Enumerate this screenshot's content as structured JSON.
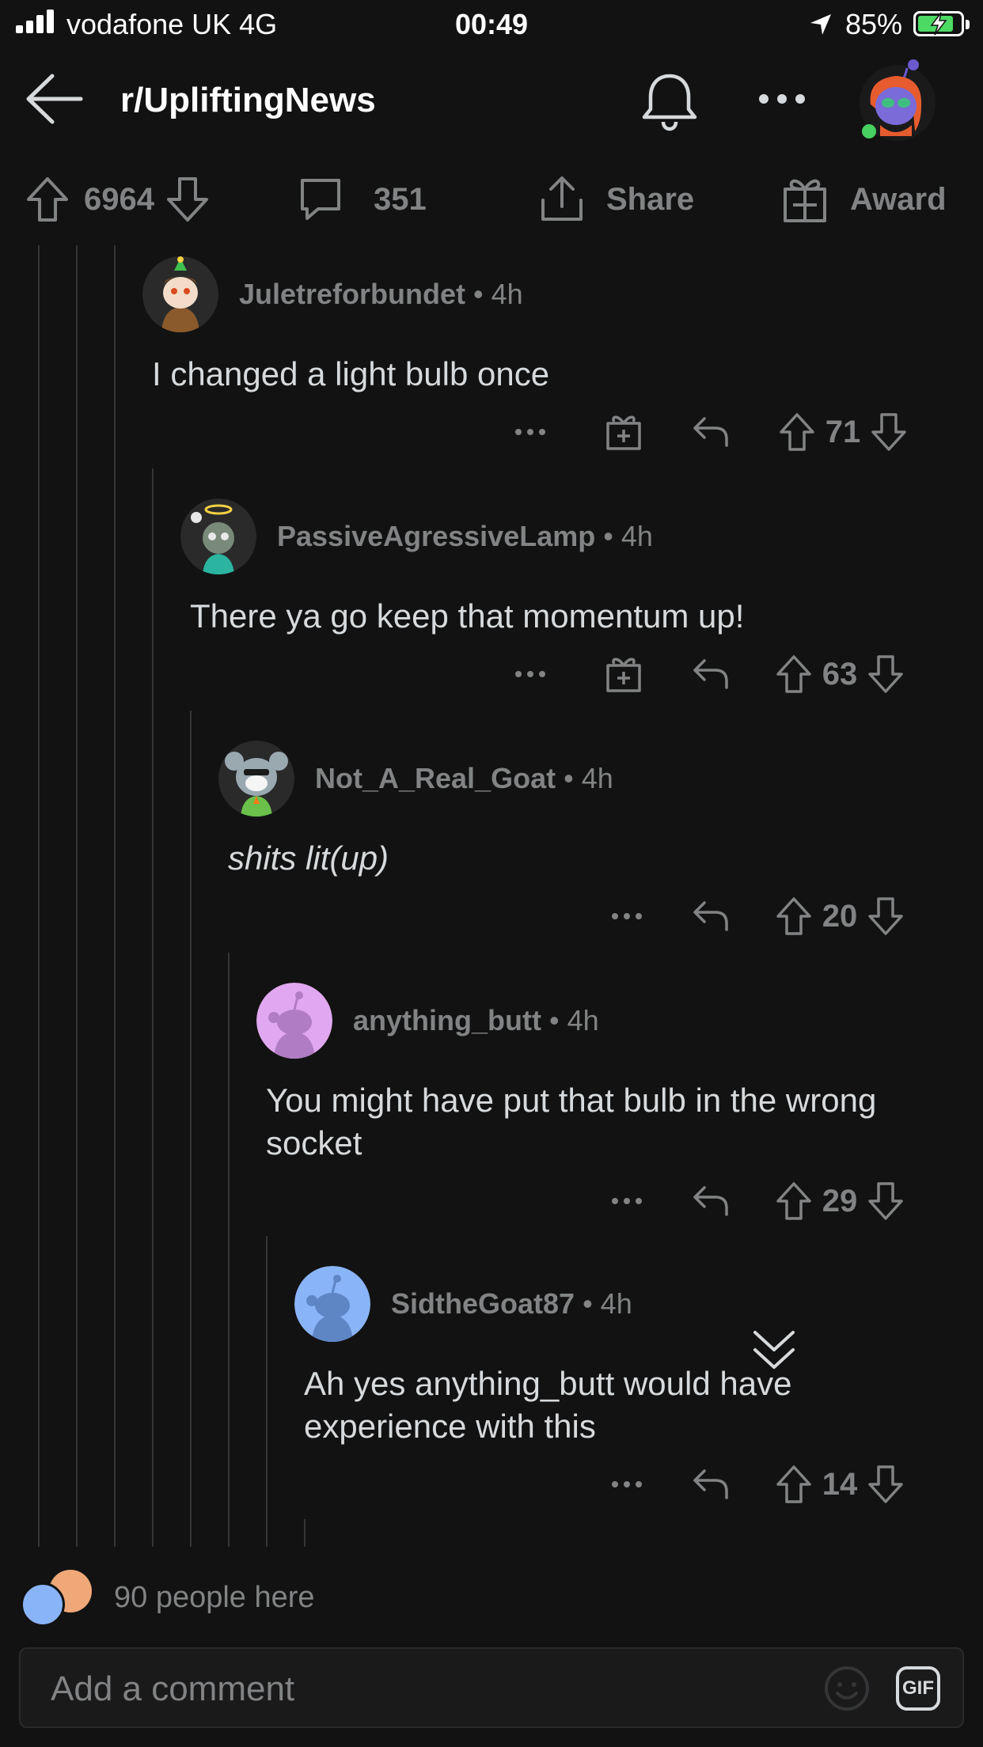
{
  "status_bar": {
    "carrier": "vodafone UK   4G",
    "time": "00:49",
    "battery_percent": "85%",
    "battery_level": 0.85,
    "battery_color": "#4cd964"
  },
  "header": {
    "subreddit": "r/UpliftingNews",
    "back_icon": "arrow-left-icon",
    "bell_icon": "bell-icon",
    "more_icon": "ellipsis-icon"
  },
  "post_actions": {
    "score": "6964",
    "comments": "351",
    "share_label": "Share",
    "award_label": "Award"
  },
  "comments": [
    {
      "user": "Juletreforbundet",
      "time": "4h",
      "body": "I changed a light bulb once",
      "score": "71",
      "has_award": true,
      "avatar_color": "#2a2a2b"
    },
    {
      "user": "PassiveAgressiveLamp",
      "time": "4h",
      "body": "There ya go keep that momentum up!",
      "score": "63",
      "has_award": true,
      "avatar_color": "#2a2a2b"
    },
    {
      "user": "Not_A_Real_Goat",
      "time": "4h",
      "body": "shits lit(up)",
      "score": "20",
      "has_award": false,
      "italic": true,
      "avatar_color": "#2a2a2b"
    },
    {
      "user": "anything_butt",
      "time": "4h",
      "body": "You might have put that bulb in the wrong\nsocket",
      "score": "29",
      "has_award": false,
      "avatar_color": "#e0a8f0"
    },
    {
      "user": "SidtheGoat87",
      "time": "4h",
      "body": "Ah yes anything_butt would have\nexperience with this",
      "score": "14",
      "has_award": false,
      "avatar_color": "#8ab4f8"
    }
  ],
  "presence": {
    "text": "90 people here"
  },
  "composer": {
    "placeholder": "Add a comment",
    "gif_label": "GIF"
  },
  "colors": {
    "background": "#121212",
    "muted": "#818384",
    "text": "#d7dadc",
    "thread_line": "#343536"
  }
}
